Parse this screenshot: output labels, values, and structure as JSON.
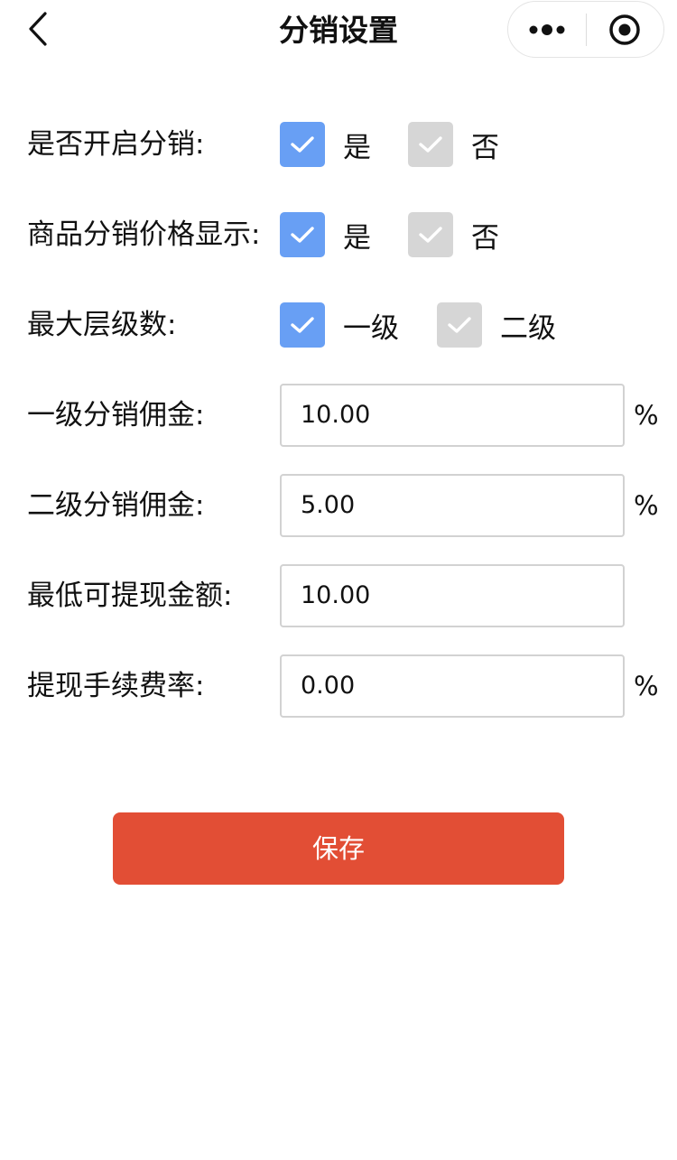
{
  "navbar": {
    "title": "分销设置",
    "back_icon": "chevron-left-icon",
    "more_icon": "more-dots-icon",
    "close_icon": "target-close-icon"
  },
  "colors": {
    "checked": "#689ff4",
    "unchecked": "#d6d6d6",
    "save_button": "#e24e35"
  },
  "form": {
    "enable_distribution": {
      "label": "是否开启分销:",
      "options": [
        {
          "label": "是",
          "checked": true
        },
        {
          "label": "否",
          "checked": false
        }
      ]
    },
    "show_price": {
      "label": "商品分销价格显示:",
      "options": [
        {
          "label": "是",
          "checked": true
        },
        {
          "label": "否",
          "checked": false
        }
      ]
    },
    "max_level": {
      "label": "最大层级数:",
      "options": [
        {
          "label": "一级",
          "checked": true
        },
        {
          "label": "二级",
          "checked": false
        }
      ]
    },
    "level1_commission": {
      "label": "一级分销佣金:",
      "value": "10.00",
      "unit": "%"
    },
    "level2_commission": {
      "label": "二级分销佣金:",
      "value": "5.00",
      "unit": "%"
    },
    "min_withdraw": {
      "label": "最低可提现金额:",
      "value": "10.00"
    },
    "withdraw_fee": {
      "label": "提现手续费率:",
      "value": "0.00",
      "unit": "%"
    }
  },
  "save_button": {
    "label": "保存"
  }
}
